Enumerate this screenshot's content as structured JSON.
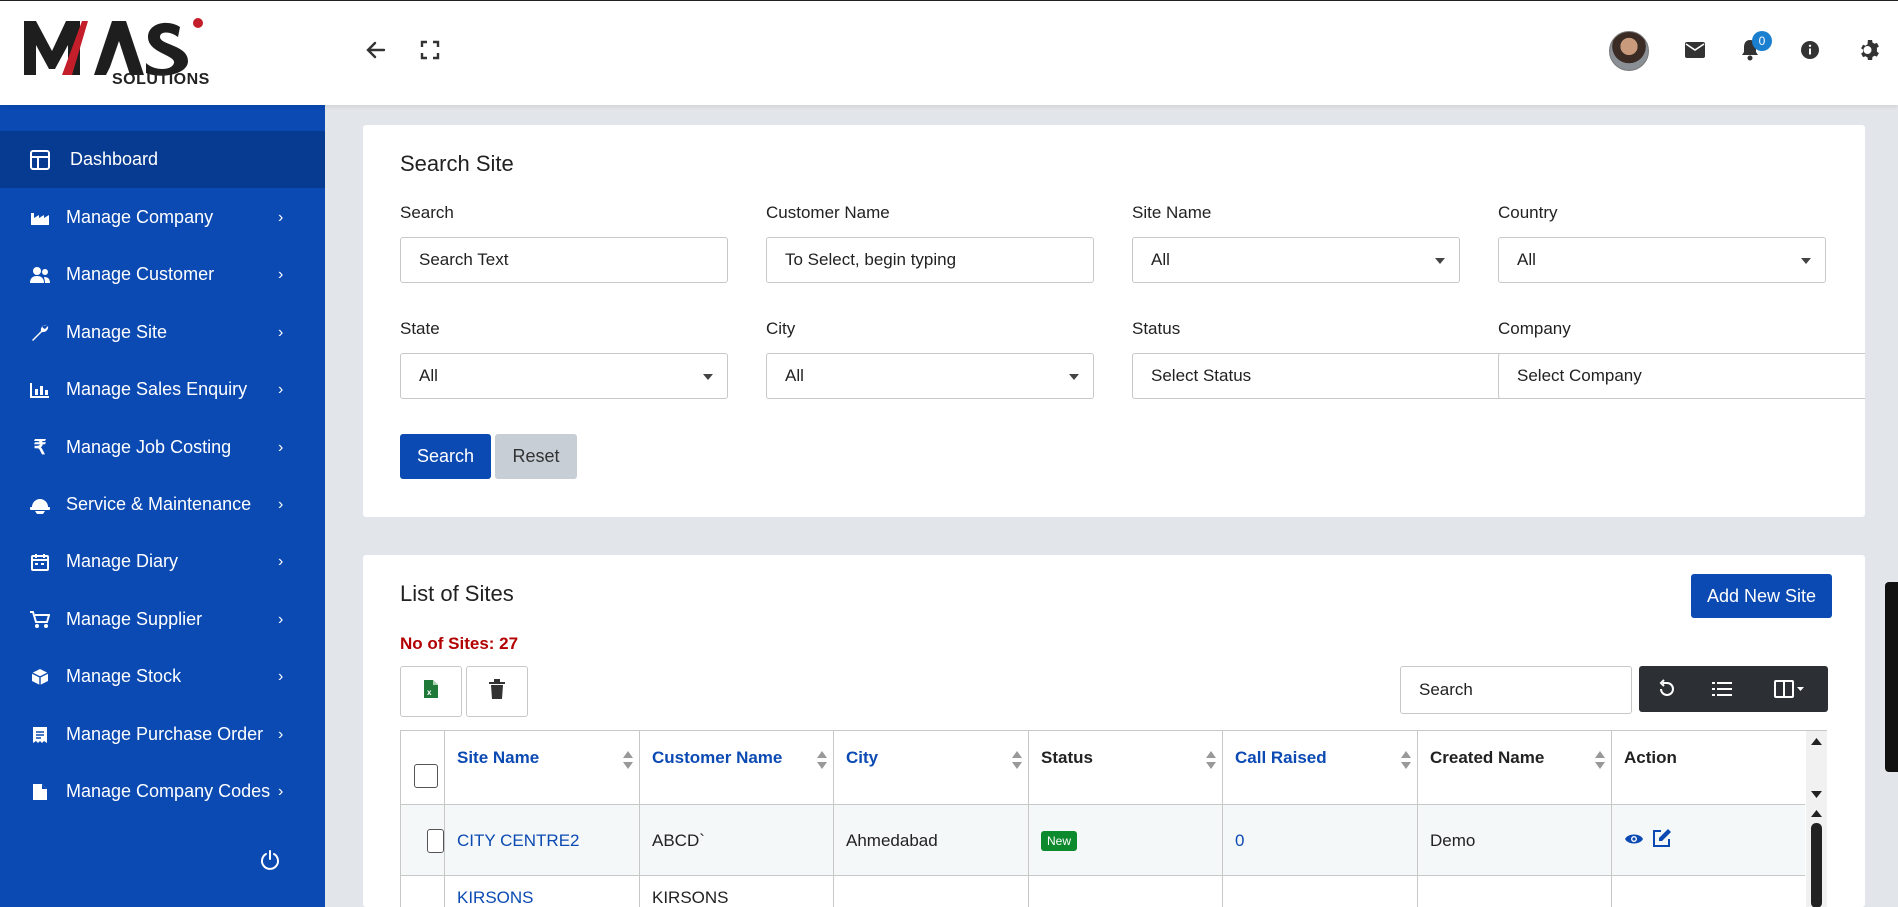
{
  "brand": {
    "logo_text": "MAS",
    "logo_sub": "SOLUTIONS"
  },
  "header": {
    "notifications_count": "0"
  },
  "sidebar": {
    "items": [
      {
        "label": "Dashboard",
        "icon": "dashboard-icon",
        "active": true
      },
      {
        "label": "Manage Company",
        "icon": "factory-icon"
      },
      {
        "label": "Manage Customer",
        "icon": "users-icon"
      },
      {
        "label": "Manage Site",
        "icon": "wrench-icon"
      },
      {
        "label": "Manage Sales Enquiry",
        "icon": "bar-chart-icon"
      },
      {
        "label": "Manage Job Costing",
        "icon": "rupee-icon"
      },
      {
        "label": "Service & Maintenance",
        "icon": "helmet-icon"
      },
      {
        "label": "Manage Diary",
        "icon": "calendar-icon"
      },
      {
        "label": "Manage Supplier",
        "icon": "cart-icon"
      },
      {
        "label": "Manage Stock",
        "icon": "box-icon"
      },
      {
        "label": "Manage Purchase Order",
        "icon": "receipt-icon"
      },
      {
        "label": "Manage Company Codes",
        "icon": "file-icon"
      }
    ]
  },
  "search_card": {
    "title": "Search Site",
    "fields": {
      "search": {
        "label": "Search",
        "placeholder": "Search Text"
      },
      "customer": {
        "label": "Customer Name",
        "placeholder": "To Select, begin typing"
      },
      "site_name": {
        "label": "Site Name",
        "value": "All"
      },
      "country": {
        "label": "Country",
        "value": "All"
      },
      "state": {
        "label": "State",
        "value": "All"
      },
      "city": {
        "label": "City",
        "value": "All"
      },
      "status": {
        "label": "Status",
        "value": "Select Status"
      },
      "company": {
        "label": "Company",
        "value": "Select Company"
      }
    },
    "search_button": "Search",
    "reset_button": "Reset"
  },
  "list_card": {
    "title": "List of Sites",
    "count_label": "No of Sites: 27",
    "add_button": "Add New Site",
    "table_search_placeholder": "Search",
    "columns": [
      "Site Name",
      "Customer Name",
      "City",
      "Status",
      "Call Raised",
      "Created Name",
      "Action"
    ],
    "rows": [
      {
        "site_name": "CITY CENTRE2",
        "customer": "ABCD`",
        "city": "Ahmedabad",
        "status": "New",
        "call_raised": "0",
        "created_name": "Demo"
      },
      {
        "site_name": "KIRSONS",
        "customer": "KIRSONS",
        "city": "",
        "status": "",
        "call_raised": "",
        "created_name": ""
      }
    ]
  },
  "colors": {
    "sidebar_bg": "#0b4ab3",
    "sidebar_active": "#073b91",
    "primary": "#0b4ab3",
    "count_red": "#b30000",
    "status_new": "#0e8a2e"
  }
}
